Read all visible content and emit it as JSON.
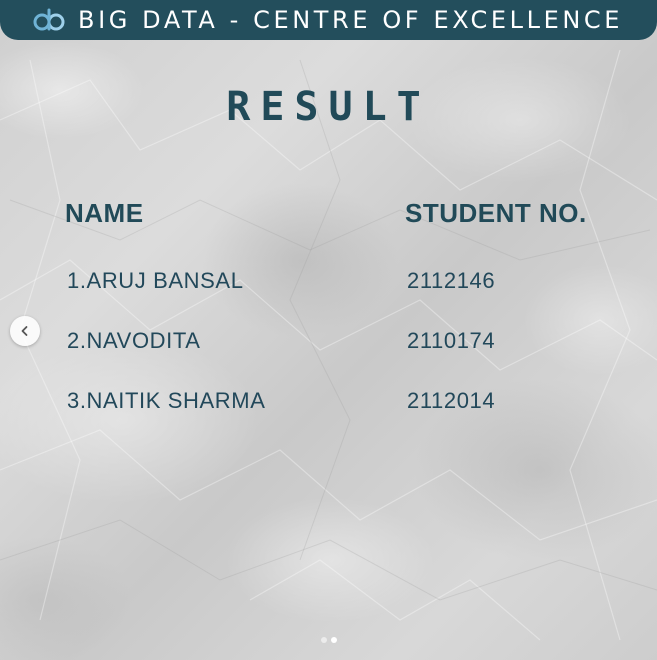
{
  "header": {
    "logo_icon": "big-data-logo-icon",
    "title": "BIG DATA - CENTRE OF EXCELLENCE"
  },
  "page": {
    "title": "RESULT"
  },
  "table": {
    "columns": [
      "NAME",
      "STUDENT NO."
    ],
    "rows": [
      {
        "name": "1.ARUJ BANSAL",
        "student_no": "2112146"
      },
      {
        "name": "2.NAVODITA",
        "student_no": "2110174"
      },
      {
        "name": "3.NAITIK SHARMA",
        "student_no": "2112014"
      }
    ]
  },
  "carousel": {
    "prev_icon": "chevron-left-icon",
    "slide_count": 2,
    "active_slide": 2
  },
  "colors": {
    "header_bg": "#234e5c",
    "text_primary": "#214a58",
    "background": "#d4d4d4"
  }
}
